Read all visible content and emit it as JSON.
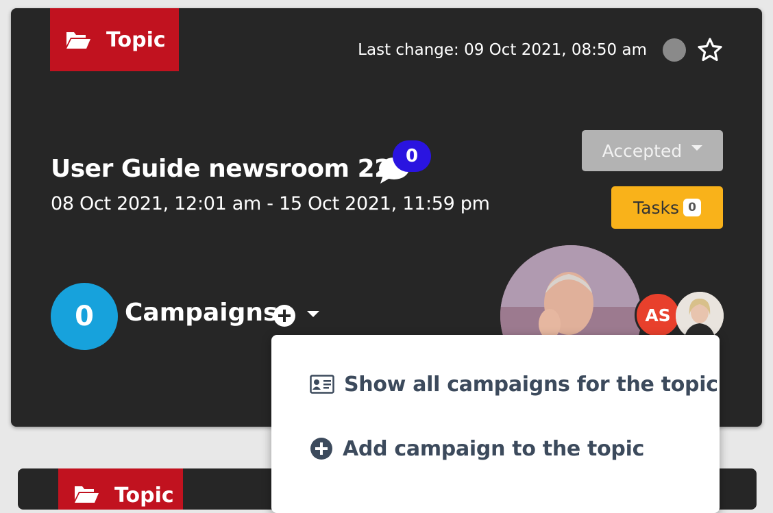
{
  "topic_card": {
    "tag_label": "Topic",
    "last_change": "Last change: 09 Oct 2021, 08:50 am",
    "title": "User Guide newsroom 22",
    "comment_count": "0",
    "date_range": "08 Oct 2021, 12:01 am - 15 Oct 2021, 11:59 pm",
    "status": "Accepted",
    "tasks_label": "Tasks",
    "tasks_count": "0",
    "campaign_count": "0",
    "campaigns_label": "Campaigns",
    "assignee_initials": "AS"
  },
  "dropdown_menu": {
    "items": [
      {
        "label": "Show all campaigns for the topic",
        "icon": "id-card-icon"
      },
      {
        "label": "Add campaign to the topic",
        "icon": "plus-circle-icon"
      }
    ]
  },
  "next_card": {
    "tag_label": "Topic"
  },
  "colors": {
    "card_bg": "#262626",
    "topic_tag": "#c1121f",
    "comment_badge": "#2a14e0",
    "status_btn": "#b3b3b3",
    "tasks_btn": "#f9b21a",
    "campaign_count": "#17a2dc",
    "initials_avatar": "#e8402c"
  }
}
